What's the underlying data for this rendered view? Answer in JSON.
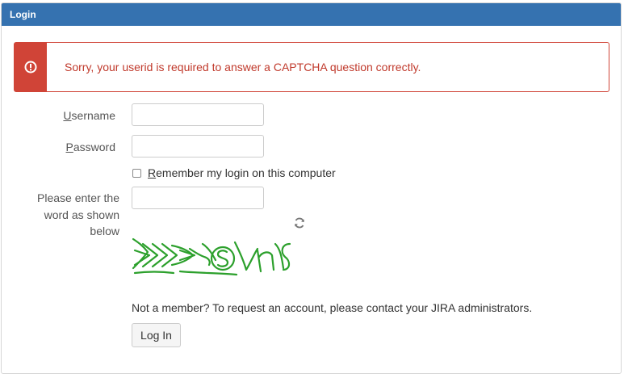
{
  "panel": {
    "title": "Login"
  },
  "alert": {
    "icon": "error-icon",
    "message": "Sorry, your userid is required to answer a CAPTCHA question correctly."
  },
  "form": {
    "username_label_key": "U",
    "username_label_rest": "sername",
    "username_value": "",
    "password_label_key": "P",
    "password_label_rest": "assword",
    "password_value": "",
    "remember_key": "R",
    "remember_rest": "emember my login on this computer",
    "remember_checked": false,
    "captcha_label": "Please enter the word as shown below",
    "captcha_value": "",
    "captcha_refresh_icon": "refresh-icon"
  },
  "footer": {
    "member_text": "Not a member? To request an account, please contact your JIRA administrators.",
    "login_button": "Log In"
  },
  "colors": {
    "header": "#3572b0",
    "error": "#d04437",
    "captcha": "#2ca02c"
  }
}
